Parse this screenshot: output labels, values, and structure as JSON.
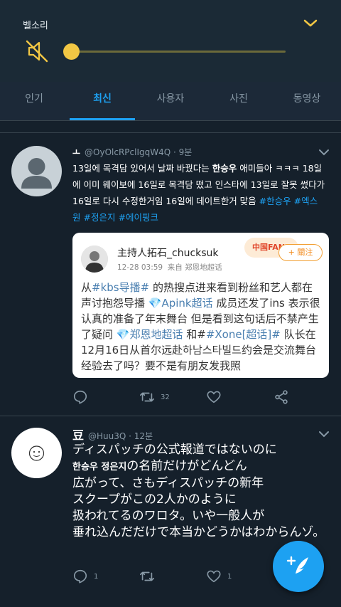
{
  "volume": {
    "title": "벨소리",
    "level": 0
  },
  "tabs": [
    {
      "label": "인기",
      "active": false
    },
    {
      "label": "최신",
      "active": true
    },
    {
      "label": "사용자",
      "active": false
    },
    {
      "label": "사진",
      "active": false
    },
    {
      "label": "동영상",
      "active": false
    }
  ],
  "tweet1": {
    "name": "ㅗ",
    "handle": "@OyOlcRPclIgqW4Q",
    "time": "· 9분",
    "text_plain": "13일에 목격담 있어서 날짜 바꿨다는 ",
    "text_bold": "한승우",
    "text_rest": " 애미들아 ㅋㅋㅋ 18일에 이미 웨이보에 16일로 목격담 떴고 인스타에 13일로 잘못 썼다가 16일로 다시 수정한거임 16일에 데이트한거 맞음 ",
    "hashtags": [
      "#한승우",
      "#엑스원",
      "#정은지",
      "#에이핑크"
    ],
    "reply_count": "",
    "retweet_count": "32",
    "like_count": "",
    "embed": {
      "name": "主持人拓石_chucksuk",
      "date": "12-28 03:59",
      "source": "来自 郑恩地超话",
      "badge": "中国FANS",
      "follow": "+ 關注",
      "p1": "从",
      "link1": "#kbs导播#",
      "p2": " 的热搜点进来看到粉丝和艺人都在声讨抱怨导播 ",
      "link2": "💎Apink超话",
      "p3": " 成员还发了ins 表示很认真的准备了年末舞台 但是看到这句话后不禁产生了疑问 ",
      "link3": "💎郑恩地超话",
      "p4": " 和#",
      "link4": "#Xone[超话]#",
      "p5": " 队长在12月16日从首尔远赴하남스타빌드约会是交流舞台经验去了吗？要不是有朋友发我照"
    }
  },
  "tweet2": {
    "name": "豆",
    "handle": "@Huu3Q",
    "time": "· 12분",
    "line1": "ディスパッチの公式報道ではないのに",
    "line2_bold": "한승우 정은지",
    "line2_rest": "の名前だけがどんどん",
    "line3": "広がって、さもディスパッチの新年",
    "line4": "スクープがこの2人かのように",
    "line5": "扱われてるのワロタ。いや一般人が",
    "line6": "垂れ込んだだけで本当かどうかはわからんゾ。",
    "reply_count": "1",
    "retweet_count": "",
    "like_count": "1"
  },
  "colors": {
    "accent": "#1da1f2",
    "volume_accent": "#f2c744",
    "background": "#15202b"
  },
  "icons": [
    "mute-icon",
    "chevron-down-icon",
    "reply-icon",
    "retweet-icon",
    "like-icon",
    "share-icon",
    "compose-icon"
  ]
}
